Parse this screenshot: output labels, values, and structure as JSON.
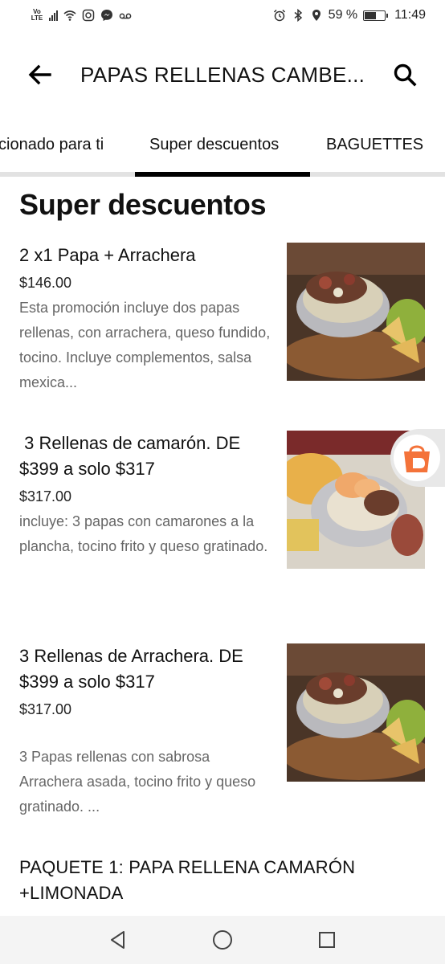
{
  "status_bar": {
    "volte_top": "Vo",
    "volte_bottom": "LTE",
    "battery_level": 0.59,
    "battery_text": "59 %",
    "time": "11:49"
  },
  "header": {
    "title": "PAPAS RELLENAS CAMBE...",
    "back_icon": "arrow-left-icon",
    "search_icon": "search-icon"
  },
  "tabs": [
    {
      "label": "cionado para ti",
      "active": false
    },
    {
      "label": "Super descuentos",
      "active": true
    },
    {
      "label": "BAGUETTES",
      "active": false
    }
  ],
  "section": {
    "title": "Super descuentos"
  },
  "items": [
    {
      "name": "2 x1 Papa + Arrachera",
      "price": "$146.00",
      "description": "Esta promoción incluye dos papas rellenas, con arrachera, queso fundido, tocino. Incluye complementos, salsa mexica..."
    },
    {
      "name": " 3 Rellenas de camarón. DE $399 a solo $317",
      "price": "$317.00",
      "description": "incluye: 3 papas con camarones a la plancha, tocino frito y queso gratinado."
    },
    {
      "name": "3 Rellenas de Arrachera. DE $399 a solo $317",
      "price": "$317.00",
      "description": "3 Papas rellenas con  sabrosa Arrachera asada, tocino frito y queso gratinado. ..."
    }
  ],
  "package_title": "PAQUETE 1: PAPA RELLENA CAMARÓN +LIMONADA",
  "colors": {
    "accent": "#000000",
    "tab_rule": "#e2e2e2",
    "description_text": "#666666",
    "float_head_orange": "#f4733a"
  },
  "nav": {
    "back": "triangle-back-icon",
    "home": "circle-home-icon",
    "recents": "square-recents-icon"
  }
}
